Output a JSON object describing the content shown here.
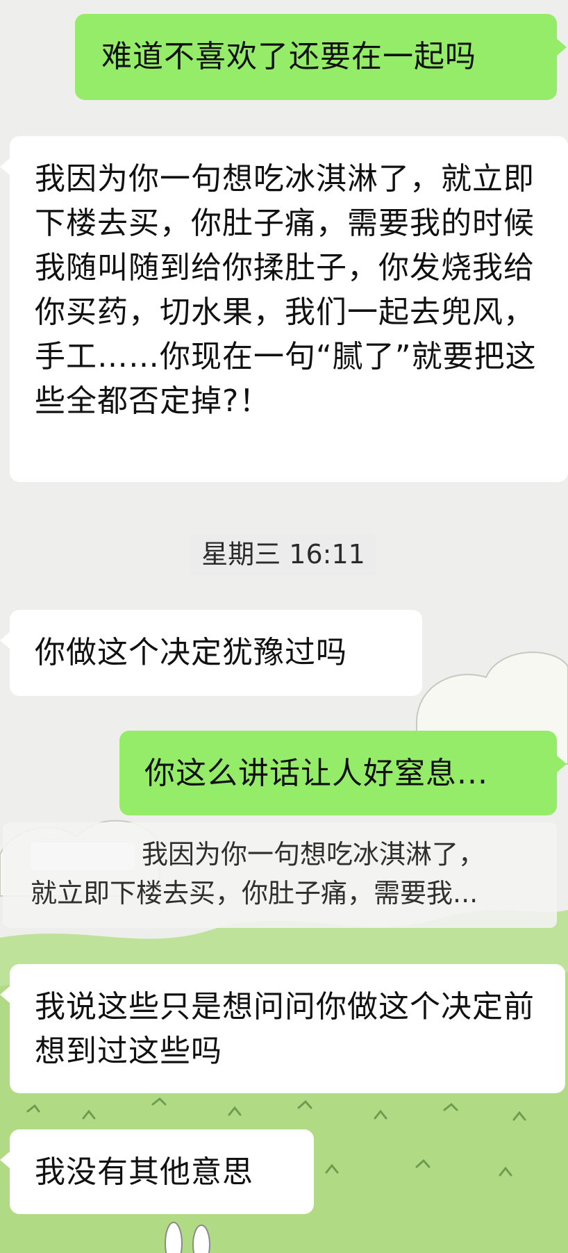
{
  "messages": [
    {
      "side": "out",
      "text": "难道不喜欢了还要在一起吗"
    },
    {
      "side": "in",
      "text": "我因为你一句想吃冰淇淋了，就立即下楼去买，你肚子痛，需要我的时候我随叫随到给你揉肚子，你发烧我给你买药，切水果，我们一起去兜风，手工……你现在一句“腻了”就要把这些全都否定掉?！"
    },
    {
      "side": "in",
      "text": "你做这个决定犹豫过吗"
    },
    {
      "side": "out",
      "text": "你这么讲话让人好窒息..."
    },
    {
      "side": "in",
      "text": "我说这些只是想问问你做这个决定前想到过这些吗"
    },
    {
      "side": "in",
      "text": "我没有其他意思"
    }
  ],
  "timestamp": "星期三 16:11",
  "quote": {
    "line1": "我因为你一句想吃冰淇淋了，",
    "line2": "就立即下楼去买，你肚子痛，需要我..."
  },
  "colors": {
    "chat_bg": "#ededed",
    "outgoing_bubble": "#95ec69",
    "incoming_bubble": "#ffffff",
    "grass": "#b4dc86",
    "cloud": "#f8f8f4"
  }
}
